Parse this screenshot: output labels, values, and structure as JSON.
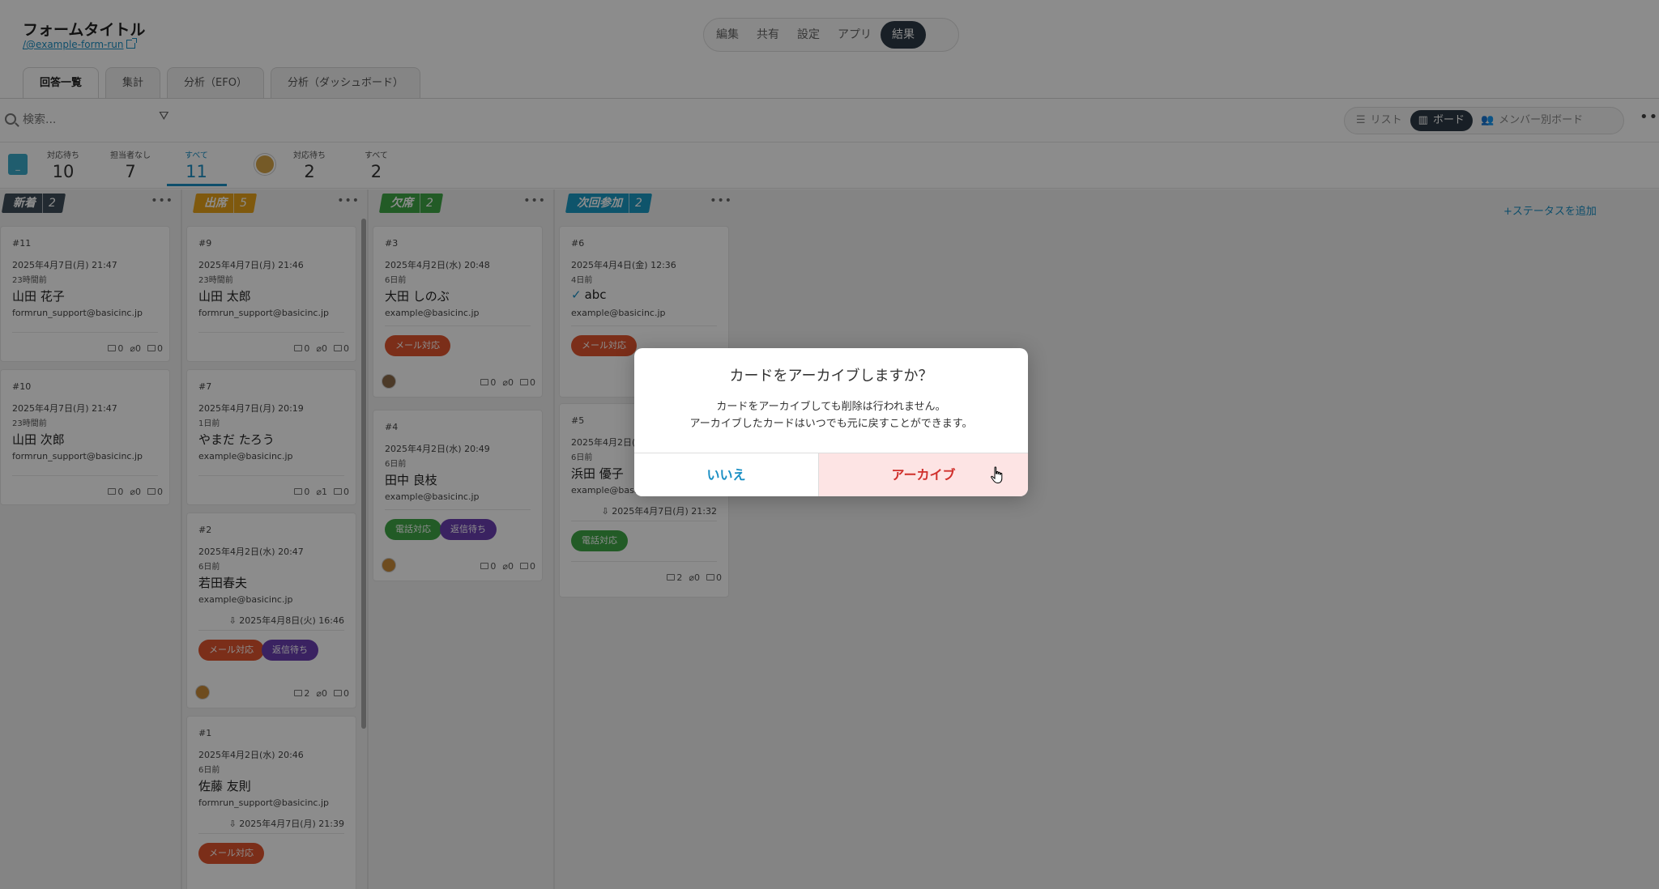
{
  "header": {
    "form_title": "フォームタイトル",
    "form_link": "/@example-form-run",
    "nav": [
      "編集",
      "共有",
      "設定",
      "アプリ",
      "結果"
    ],
    "tabs": [
      "回答一覧",
      "集計",
      "分析（EFO）",
      "分析（ダッシュボード）"
    ]
  },
  "toolbar": {
    "search_placeholder": "検索...",
    "views": [
      "リスト",
      "ボード",
      "メンバー別ボード"
    ]
  },
  "summary": {
    "badge": "_",
    "counters": [
      {
        "label": "対応待ち",
        "value": "10"
      },
      {
        "label": "担当者なし",
        "value": "7"
      },
      {
        "label": "すべて",
        "value": "11"
      },
      {
        "label": "対応待ち",
        "value": "2"
      },
      {
        "label": "すべて",
        "value": "2"
      }
    ]
  },
  "board": {
    "add_status": "+ステータスを追加",
    "columns": [
      {
        "name": "新着",
        "count": "2",
        "color": "#3e4d59",
        "cards": [
          {
            "no": "#11",
            "date": "2025年4月7日(月) 21:47",
            "ago": "23時間前",
            "name": "山田 花子",
            "email": "formrun_support@basicinc.jp",
            "mail": "0",
            "clip": "0",
            "comment": "0"
          },
          {
            "no": "#10",
            "date": "2025年4月7日(月) 21:47",
            "ago": "23時間前",
            "name": "山田 次郎",
            "email": "formrun_support@basicinc.jp",
            "mail": "0",
            "clip": "0",
            "comment": "0"
          }
        ]
      },
      {
        "name": "出席",
        "count": "5",
        "color": "#e8a21a",
        "cards": [
          {
            "no": "#9",
            "date": "2025年4月7日(月) 21:46",
            "ago": "23時間前",
            "name": "山田 太郎",
            "email": "formrun_support@basicinc.jp",
            "mail": "0",
            "clip": "0",
            "comment": "0"
          },
          {
            "no": "#7",
            "date": "2025年4月7日(月) 20:19",
            "ago": "1日前",
            "name": "やまだ たろう",
            "email": "example@basicinc.jp",
            "mail": "0",
            "clip": "1",
            "comment": "0"
          },
          {
            "no": "#2",
            "date": "2025年4月2日(水) 20:47",
            "ago": "6日前",
            "name": "若田春夫",
            "email": "example@basicinc.jp",
            "reply": "2025年4月8日(火) 16:46",
            "tags": [
              "メール対応",
              "返信待ち"
            ],
            "mail": "2",
            "clip": "0",
            "comment": "0"
          },
          {
            "no": "#1",
            "date": "2025年4月2日(水) 20:46",
            "ago": "6日前",
            "name": "佐藤 友則",
            "email": "formrun_support@basicinc.jp",
            "reply": "2025年4月7日(月) 21:39",
            "tags": [
              "メール対応"
            ]
          }
        ]
      },
      {
        "name": "欠席",
        "count": "2",
        "color": "#3ea746",
        "cards": [
          {
            "no": "#3",
            "date": "2025年4月2日(水) 20:48",
            "ago": "6日前",
            "name": "大田 しのぶ",
            "email": "example@basicinc.jp",
            "tags": [
              "メール対応"
            ],
            "mail": "0",
            "clip": "0",
            "comment": "0"
          },
          {
            "no": "#4",
            "date": "2025年4月2日(水) 20:49",
            "ago": "6日前",
            "name": "田中 良枝",
            "email": "example@basicinc.jp",
            "tags": [
              "電話対応",
              "返信待ち"
            ],
            "mail": "0",
            "clip": "0",
            "comment": "0"
          }
        ]
      },
      {
        "name": "次回参加",
        "count": "2",
        "color": "#1a9ac4",
        "cards": [
          {
            "no": "#6",
            "date": "2025年4月4日(金) 12:36",
            "ago": "4日前",
            "name": "abc",
            "email": "example@basicinc.jp",
            "tags": [
              "メール対応"
            ]
          },
          {
            "no": "#5",
            "date": "2025年4月2日(水",
            "ago": "6日前",
            "name": "浜田 優子",
            "email": "example@basicinc.jp",
            "reply": "2025年4月7日(月) 21:32",
            "tags": [
              "電話対応"
            ],
            "mail": "2",
            "clip": "0",
            "comment": "0"
          }
        ]
      }
    ]
  },
  "modal": {
    "title": "カードをアーカイブしますか？",
    "line1": "カードをアーカイブしても削除は行われません。",
    "line2": "アーカイブしたカードはいつでも元に戻すことができます。",
    "no_label": "いいえ",
    "yes_label": "アーカイブ"
  },
  "colors": {
    "accent": "#1a8fc4",
    "danger": "#d0302c",
    "tag_mail": "#e0552f",
    "tag_wait": "#6b3fb1",
    "tag_phone": "#3ea746"
  }
}
